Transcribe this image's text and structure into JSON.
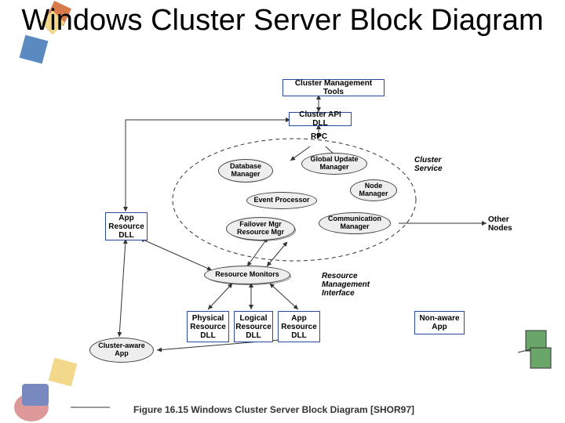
{
  "title": "Windows Cluster Server Block Diagram",
  "caption": "Figure 16.15   Windows Cluster Server Block Diagram [SHOR97]",
  "boxes": {
    "cmt": "Cluster Management Tools",
    "api": "Cluster API DLL",
    "ard": "App\nResource\nDLL",
    "prd": "Physical\nResource\nDLL",
    "lrd": "Logical\nResource\nDLL",
    "ard2": "App\nResource\nDLL",
    "naa": "Non-aware\nApp"
  },
  "ellipses": {
    "dbm": "Database\nManager",
    "gum": "Global Update\nManager",
    "nm": "Node\nManager",
    "ep": "Event Processor",
    "fm": "Failover Mgr\nResource Mgr",
    "cm": "Communication\nManager",
    "rm": "Resource Monitors",
    "ca": "Cluster-aware\nApp"
  },
  "labels": {
    "rpc": "RPC",
    "cs": "Cluster\nService",
    "rmi": "Resource\nManagement\nInterface",
    "on": "Other\nNodes"
  }
}
